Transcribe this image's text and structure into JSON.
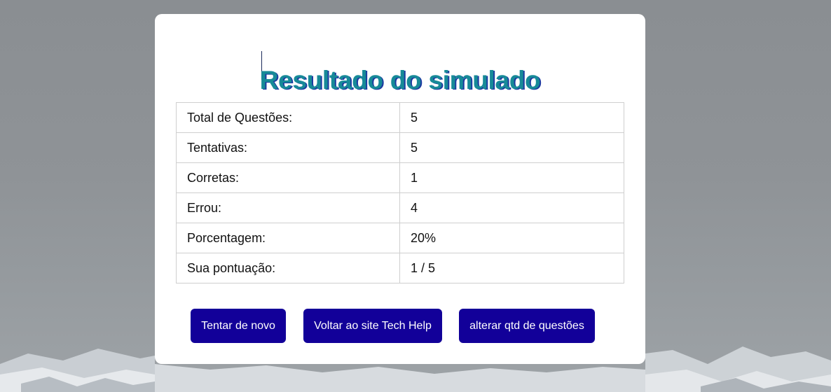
{
  "page": {
    "title": "Resultado do simulado"
  },
  "results": [
    {
      "label": "Total de Questões:",
      "value": "5"
    },
    {
      "label": "Tentativas:",
      "value": "5"
    },
    {
      "label": "Corretas:",
      "value": "1"
    },
    {
      "label": "Errou:",
      "value": "4"
    },
    {
      "label": "Porcentagem:",
      "value": "20%"
    },
    {
      "label": "Sua pontuação:",
      "value": "1 / 5"
    }
  ],
  "actions": {
    "retry_label": "Tentar de novo",
    "back_label": "Voltar ao site Tech Help",
    "change_label": "alterar qtd de questões"
  },
  "colors": {
    "title": "#178a98",
    "title_shadow": "#1c3aa0",
    "button": "#120099",
    "card": "#ffffff"
  }
}
